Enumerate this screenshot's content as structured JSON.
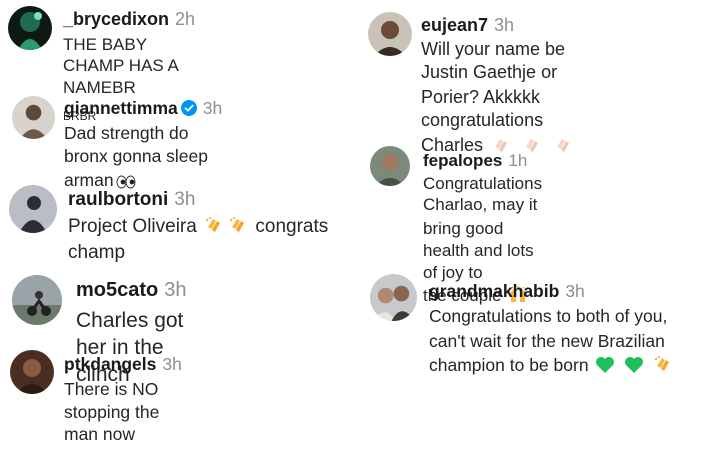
{
  "left": [
    {
      "user": "_brycedixon",
      "time": "2h",
      "text": "THE BABY CHAMP HAS A NAMEBR",
      "text2": "BRBR"
    },
    {
      "user": "giannettimma",
      "time": "3h",
      "text": "Dad strength do bronx gonna sleep",
      "text2": "arman"
    },
    {
      "user": "raulbortoni",
      "time": "3h",
      "text": "Project Oliveira",
      "text_after": "congrats",
      "text2": "champ"
    },
    {
      "user": "mo5cato",
      "time": "3h",
      "text": "Charles got her in the clinch"
    },
    {
      "user": "ptkdangels",
      "time": "3h",
      "text": "There is NO stopping the man now"
    }
  ],
  "right": [
    {
      "user": "eujean7",
      "time": "3h",
      "text": "Will your name be Justin Gaethje or",
      "text2": "Porier? Akkkkk congratulations",
      "text3": "Charles"
    },
    {
      "user": "fepalopes",
      "time": "1h",
      "text": "Congratulations Charlao, may it",
      "text2": "bring good health and lots of joy to",
      "text3": "the couple"
    },
    {
      "user": "grandmakhabib",
      "time": "3h",
      "text": "Congratulations to both of you,",
      "text2": "can't wait for the new Brazilian",
      "text3": "champion to be born"
    }
  ],
  "icons": {
    "verified": "verified-badge-icon",
    "eyes": "eyes-emoji-icon",
    "clap": "clapping-hands-emoji-icon",
    "raised_hands": "raising-hands-emoji-icon",
    "green_heart": "green-heart-emoji-icon"
  },
  "colors": {
    "verified": "#0095f6",
    "time": "#8e8e8e",
    "emoji_yellow": "#f7b93a",
    "green_heart": "#1fbf5a"
  }
}
